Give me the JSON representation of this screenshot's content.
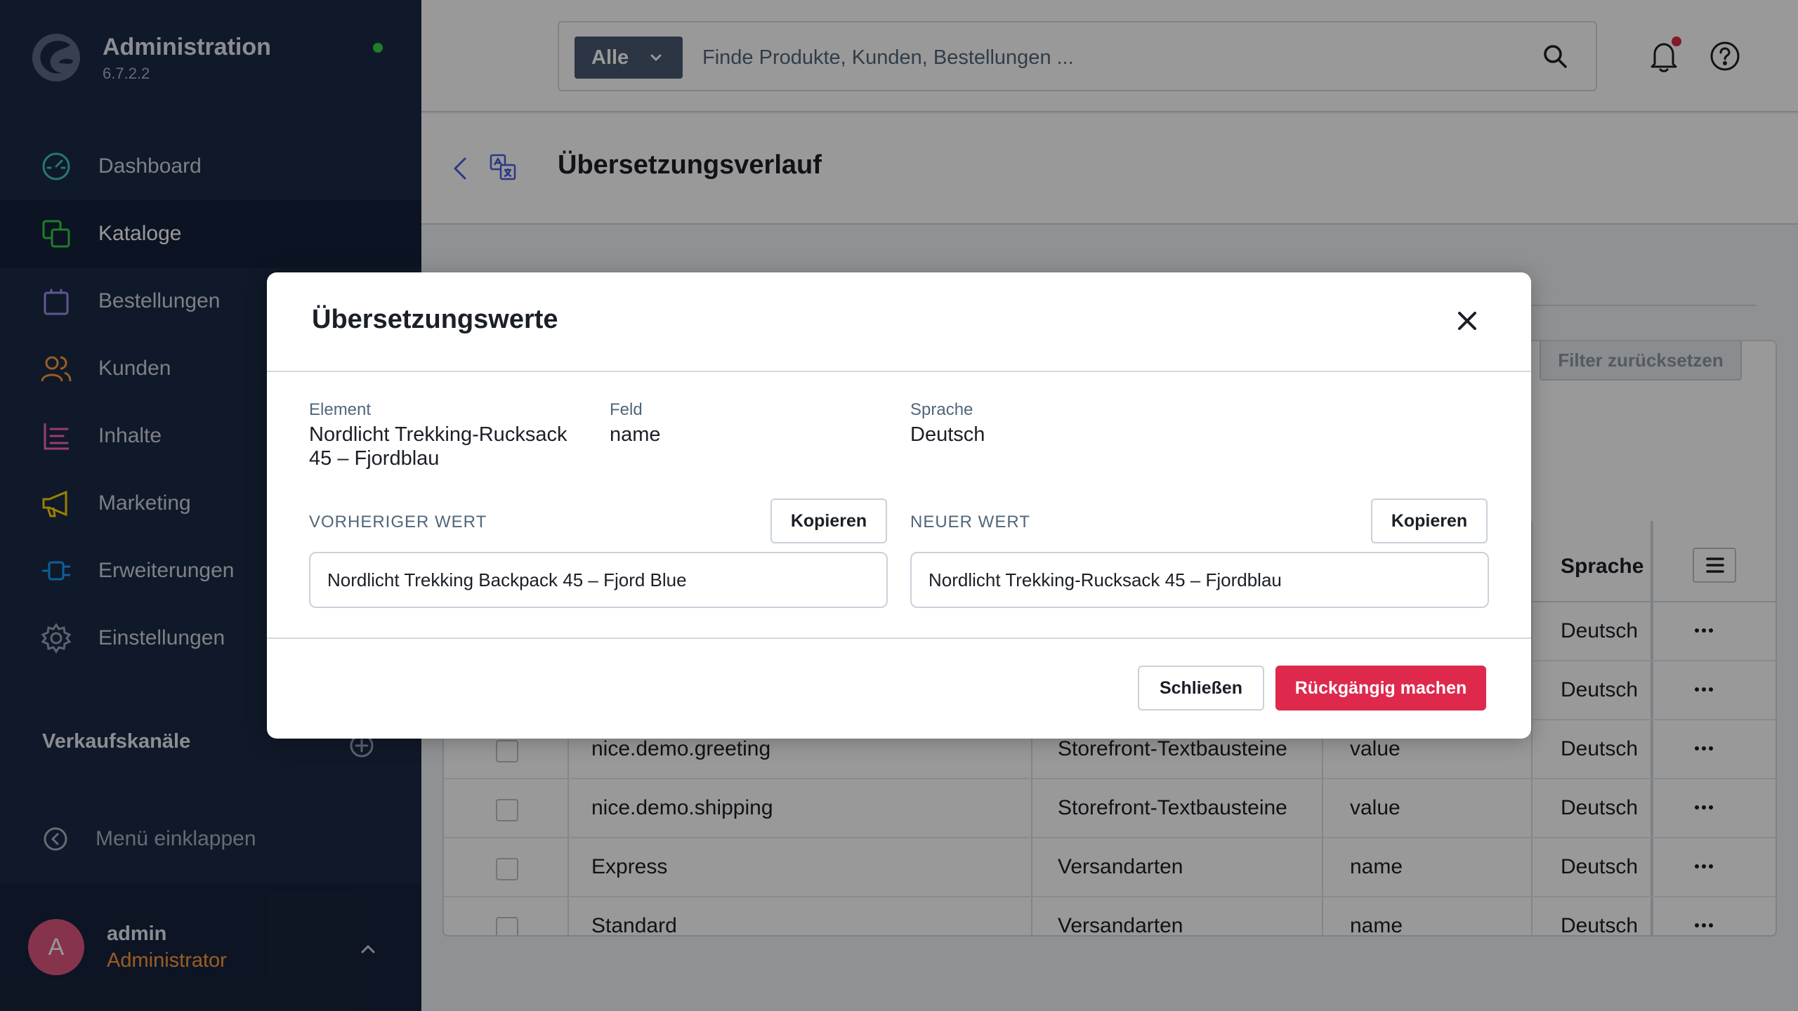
{
  "sidebar": {
    "title": "Administration",
    "version": "6.7.2.2",
    "items": [
      {
        "label": "Dashboard",
        "icon": "dashboard-icon"
      },
      {
        "label": "Kataloge",
        "icon": "catalogue-icon"
      },
      {
        "label": "Bestellungen",
        "icon": "orders-icon"
      },
      {
        "label": "Kunden",
        "icon": "customers-icon"
      },
      {
        "label": "Inhalte",
        "icon": "content-icon"
      },
      {
        "label": "Marketing",
        "icon": "marketing-icon"
      },
      {
        "label": "Erweiterungen",
        "icon": "extensions-icon"
      },
      {
        "label": "Einstellungen",
        "icon": "settings-icon"
      }
    ],
    "active_item": "Kataloge",
    "sales_channels_label": "Verkaufskanäle",
    "collapse_label": "Menü einklappen",
    "user": {
      "initial": "A",
      "name": "admin",
      "role": "Administrator"
    }
  },
  "topbar": {
    "search_type": "Alle",
    "search_placeholder": "Finde Produkte, Kunden, Bestellungen ..."
  },
  "page": {
    "title": "Übersetzungsverlauf",
    "filter_reset_label": "Filter zurücksetzen",
    "table": {
      "visible_header": "Sprache",
      "rows": [
        {
          "element": "",
          "entity": "",
          "field": "",
          "language": "Deutsch"
        },
        {
          "element": "",
          "entity": "",
          "field": "",
          "language": "Deutsch"
        },
        {
          "element": "nice.demo.greeting",
          "entity": "Storefront-Textbausteine",
          "field": "value",
          "language": "Deutsch"
        },
        {
          "element": "nice.demo.shipping",
          "entity": "Storefront-Textbausteine",
          "field": "value",
          "language": "Deutsch"
        },
        {
          "element": "Express",
          "entity": "Versandarten",
          "field": "name",
          "language": "Deutsch"
        },
        {
          "element": "Standard",
          "entity": "Versandarten",
          "field": "name",
          "language": "Deutsch"
        }
      ]
    }
  },
  "modal": {
    "title": "Übersetzungswerte",
    "element_label": "Element",
    "element_value": "Nordlicht Trekking-Rucksack 45 – Fjordblau",
    "field_label": "Feld",
    "field_value": "name",
    "language_label": "Sprache",
    "language_value": "Deutsch",
    "previous_label": "VORHERIGER WERT",
    "previous_value": "Nordlicht Trekking Backpack 45 – Fjord Blue",
    "new_label": "NEUER WERT",
    "new_value": "Nordlicht Trekking-Rucksack 45 – Fjordblau",
    "copy_label": "Kopieren",
    "close_label": "Schließen",
    "revert_label": "Rückgängig machen"
  },
  "colors": {
    "sidebar_bg": "#1b2a45",
    "primary_danger": "#de294c",
    "user_role": "#ff9c3c",
    "status_online": "#37d046"
  }
}
